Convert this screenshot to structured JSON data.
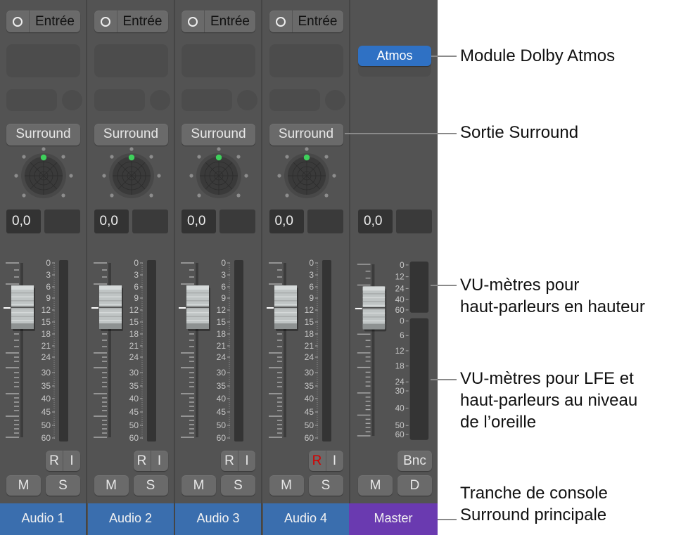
{
  "mixer": {
    "channel_strips": [
      {
        "name": "Audio 1",
        "input_label": "Entrée",
        "output_label": "Surround",
        "volume": "0,0",
        "rec_armed": false,
        "record_label": "R",
        "input_monitor_label": "I",
        "mute_label": "M",
        "solo_label": "S",
        "name_color": "#3a6eae"
      },
      {
        "name": "Audio 2",
        "input_label": "Entrée",
        "output_label": "Surround",
        "volume": "0,0",
        "rec_armed": false,
        "record_label": "R",
        "input_monitor_label": "I",
        "mute_label": "M",
        "solo_label": "S",
        "name_color": "#3a6eae"
      },
      {
        "name": "Audio 3",
        "input_label": "Entrée",
        "output_label": "Surround",
        "volume": "0,0",
        "rec_armed": false,
        "record_label": "R",
        "input_monitor_label": "I",
        "mute_label": "M",
        "solo_label": "S",
        "name_color": "#3a6eae"
      },
      {
        "name": "Audio 4",
        "input_label": "Entrée",
        "output_label": "Surround",
        "volume": "0,0",
        "rec_armed": true,
        "record_label": "R",
        "input_monitor_label": "I",
        "mute_label": "M",
        "solo_label": "S",
        "name_color": "#3a6eae"
      }
    ],
    "master_strip": {
      "name": "Master",
      "plugin_label": "Atmos",
      "volume": "0,0",
      "bounce_label": "Bnc",
      "mute_label": "M",
      "dim_label": "D",
      "name_color": "#6a3ab0",
      "height_meter_scale": [
        "0",
        "12",
        "24",
        "40",
        "60"
      ],
      "ear_meter_scale": [
        "0",
        "6",
        "12",
        "18",
        "24",
        "30",
        "40",
        "50",
        "60"
      ]
    },
    "channel_meter_scale": [
      "0",
      "3",
      "6",
      "9",
      "12",
      "15",
      "18",
      "21",
      "24",
      "30",
      "35",
      "40",
      "45",
      "50",
      "60"
    ],
    "panner_color": "#3ed05b"
  },
  "callouts": [
    {
      "id": "atmos",
      "text": "Module Dolby Atmos"
    },
    {
      "id": "surround-output",
      "text": "Sortie Surround"
    },
    {
      "id": "height-meters",
      "line1": "VU-mètres pour",
      "line2": "haut-parleurs en hauteur"
    },
    {
      "id": "ear-meters",
      "line1": "VU-mètres pour LFE et",
      "line2": "haut-parleurs au niveau",
      "line3": "de l’oreille"
    },
    {
      "id": "master-strip",
      "line1": "Tranche de console",
      "line2": "Surround principale"
    }
  ]
}
